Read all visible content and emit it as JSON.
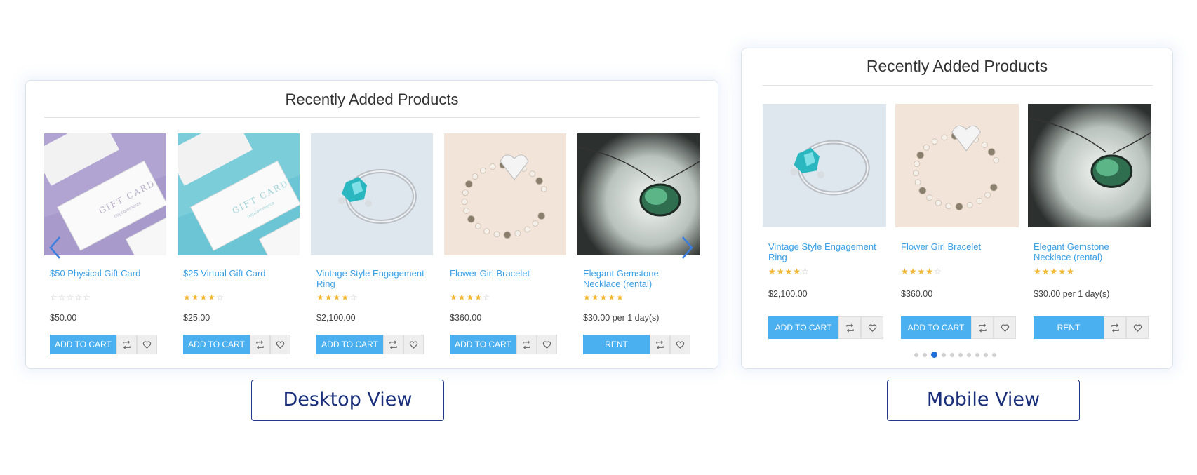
{
  "desktop": {
    "title": "Recently Added Products",
    "products": [
      {
        "name": "$50 Physical Gift Card",
        "rating": 0,
        "price": "$50.00",
        "action": "ADD TO CART",
        "image": "gift-card-purple"
      },
      {
        "name": "$25 Virtual Gift Card",
        "rating": 4,
        "price": "$25.00",
        "action": "ADD TO CART",
        "image": "gift-card-teal"
      },
      {
        "name": "Vintage Style Engagement Ring",
        "rating": 4,
        "price": "$2,100.00",
        "action": "ADD TO CART",
        "image": "ring"
      },
      {
        "name": "Flower Girl Bracelet",
        "rating": 4,
        "price": "$360.00",
        "action": "ADD TO CART",
        "image": "bracelet"
      },
      {
        "name": "Elegant Gemstone Necklace (rental)",
        "rating": 5,
        "price": "$30.00 per 1 day(s)",
        "action": "RENT",
        "image": "necklace"
      }
    ],
    "caption": "Desktop View"
  },
  "mobile": {
    "title": "Recently Added Products",
    "products": [
      {
        "name": "Vintage Style Engagement Ring",
        "rating": 4,
        "price": "$2,100.00",
        "action": "ADD TO CART",
        "image": "ring"
      },
      {
        "name": "Flower Girl Bracelet",
        "rating": 4,
        "price": "$360.00",
        "action": "ADD TO CART",
        "image": "bracelet"
      },
      {
        "name": "Elegant Gemstone Necklace (rental)",
        "rating": 5,
        "price": "$30.00 per 1 day(s)",
        "action": "RENT",
        "image": "necklace"
      }
    ],
    "pagination": {
      "total": 10,
      "active": 3
    },
    "caption": "Mobile View"
  },
  "icons": {
    "compare": "compare-icon",
    "wishlist": "heart-icon",
    "prev": "chevron-left-icon",
    "next": "chevron-right-icon"
  },
  "colors": {
    "accent": "#4ab0f0",
    "link": "#3aa0e6",
    "star": "#f2b632",
    "caption": "#1a2f7a",
    "dot_active": "#1e6fd9"
  }
}
